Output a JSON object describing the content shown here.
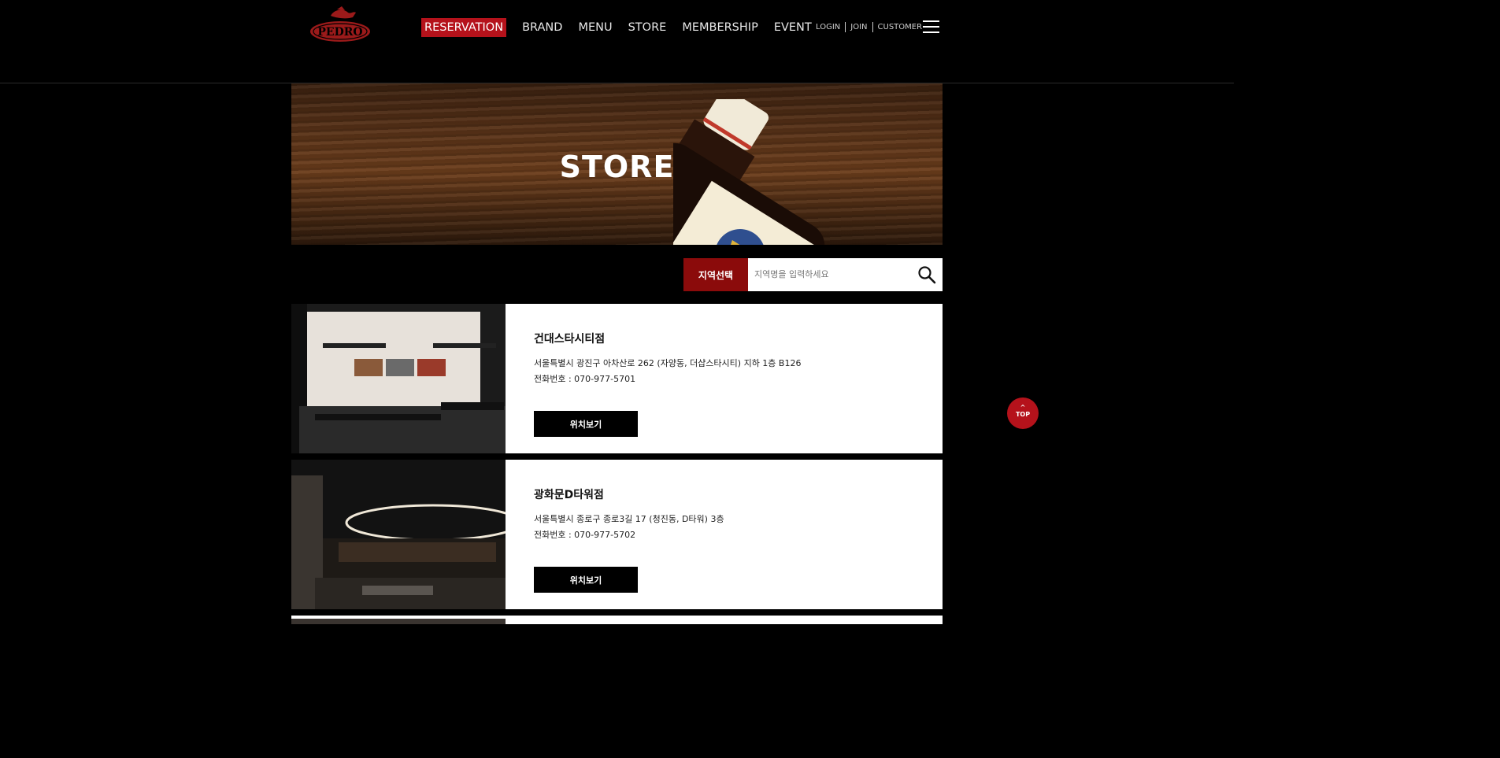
{
  "header": {
    "logo_text": "PEDRO",
    "nav": {
      "reservation": "RESERVATION",
      "brand": "BRAND",
      "menu": "MENU",
      "store": "STORE",
      "membership": "MEMBERSHIP",
      "event": "EVENT"
    },
    "util": {
      "login": "LOGIN",
      "join": "JOIN",
      "customer": "CUSTOMER"
    }
  },
  "banner": {
    "title": "STORE"
  },
  "search": {
    "region_label": "지역선택",
    "placeholder": "지역명을 입력하세요"
  },
  "stores": [
    {
      "name": "건대스타시티점",
      "address": "서울특별시 광진구 아차산로 262 (자양동, 더샵스타시티) 지하 1층 B126",
      "phone": "전화번호 : 070-977-5701",
      "button": "위치보기"
    },
    {
      "name": "광화문D타워점",
      "address": "서울특별시 종로구 종로3길 17 (청진동, D타워) 3층",
      "phone": "전화번호 : 070-977-5702",
      "button": "위치보기"
    }
  ],
  "top_button": "TOP",
  "colors": {
    "accent_red": "#b5121b",
    "region_red": "#8b0b0b",
    "background": "#000000"
  }
}
